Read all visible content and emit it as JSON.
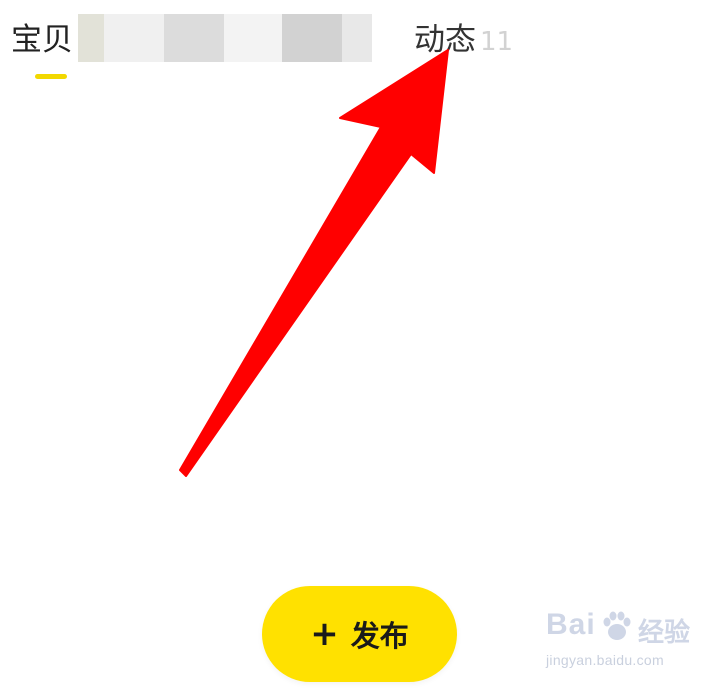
{
  "tabs": [
    {
      "label": "宝贝",
      "active": true
    },
    {
      "label": "动态",
      "count": "11",
      "active": false
    }
  ],
  "colors": {
    "accent": "#ffe100",
    "indicator": "#f2d800",
    "arrow": "#ff0000"
  },
  "publish": {
    "icon": "plus-icon",
    "label": "发布"
  },
  "watermark": {
    "brand": "Bai",
    "brand_cn": "经验",
    "url": "jingyan.baidu.com"
  }
}
